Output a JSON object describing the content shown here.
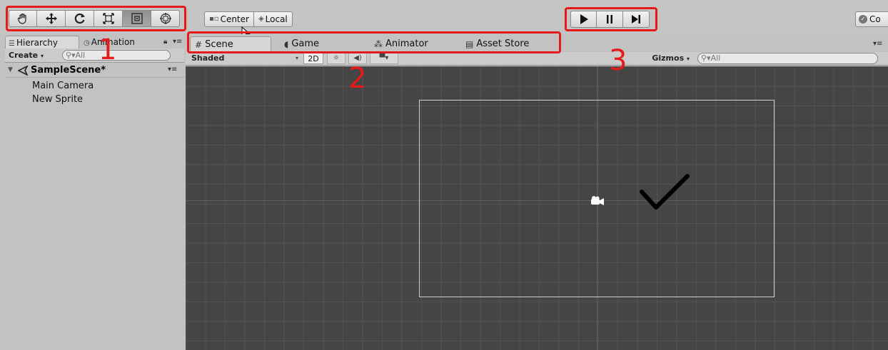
{
  "toolbar": {
    "pivot_center": "Center",
    "pivot_local": "Local",
    "collab_label": "Co"
  },
  "hierarchy": {
    "tab_hierarchy": "Hierarchy",
    "tab_animation": "Animation",
    "create_label": "Create",
    "search_placeholder": "All",
    "scene_name": "SampleScene*",
    "items": [
      "Main Camera",
      "New Sprite"
    ]
  },
  "scene_view": {
    "tabs": [
      "Scene",
      "Game",
      "Animator",
      "Asset Store"
    ],
    "shading_mode": "Shaded",
    "mode_2d": "2D",
    "gizmos_label": "Gizmos",
    "search_placeholder": "All"
  },
  "annotations": {
    "labels": [
      "1",
      "2",
      "3"
    ],
    "color": "#e51b1b"
  },
  "colors": {
    "viewport_bg": "#454545",
    "grid_line": "#525252",
    "panel_bg": "#c2c2c2"
  }
}
